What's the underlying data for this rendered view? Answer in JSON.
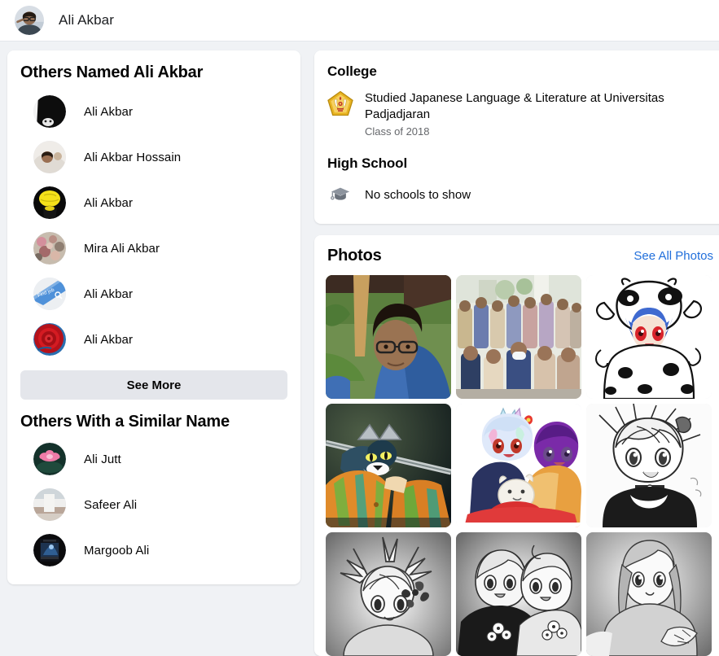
{
  "header": {
    "profile_name": "Ali Akbar",
    "avatar_alt": "profile-photo-man-with-glasses"
  },
  "sidebar": {
    "others_named": {
      "title": "Others Named Ali Akbar",
      "people": [
        {
          "name": "Ali Akbar",
          "avatar": "dark-portrait"
        },
        {
          "name": "Ali Akbar Hossain",
          "avatar": "light-portrait"
        },
        {
          "name": "Ali Akbar",
          "avatar": "yellow-mask-portrait"
        },
        {
          "name": "Mira Ali Akbar",
          "avatar": "floral-group-photo"
        },
        {
          "name": "Ali Akbar",
          "avatar": "find-job-blue-banner"
        },
        {
          "name": "Ali Akbar",
          "avatar": "red-rose"
        }
      ],
      "see_more_label": "See More"
    },
    "similar_name": {
      "title": "Others With a Similar Name",
      "people": [
        {
          "name": "Ali Jutt",
          "avatar": "pink-lotus-flower"
        },
        {
          "name": "Safeer Ali",
          "avatar": "pale-interior-photo"
        },
        {
          "name": "Margoob Ali",
          "avatar": "dark-poster-artwork"
        }
      ]
    }
  },
  "education": {
    "college": {
      "heading": "College",
      "primary": "Studied Japanese Language & Literature at Universitas Padjadjaran",
      "secondary": "Class of 2018",
      "icon": "university-crest-icon"
    },
    "high_school": {
      "heading": "High School",
      "empty_text": "No schools to show",
      "icon": "graduation-cap-icon"
    }
  },
  "photos": {
    "title": "Photos",
    "see_all_label": "See All Photos",
    "tiles": [
      {
        "alt": "man-with-glasses-outdoors",
        "kind": "portrait-outdoor"
      },
      {
        "alt": "group-photo-in-yukata",
        "kind": "group-photo"
      },
      {
        "alt": "anime-girl-in-cow-hood",
        "kind": "anime-cow"
      },
      {
        "alt": "anime-cat-with-sword",
        "kind": "anime-cat-sword"
      },
      {
        "alt": "two-anime-girls-with-cat",
        "kind": "anime-duo-color"
      },
      {
        "alt": "monochrome-anime-boy-smiling",
        "kind": "anime-mono-1"
      },
      {
        "alt": "monochrome-anime-boy-with-flower",
        "kind": "anime-mono-2"
      },
      {
        "alt": "monochrome-anime-couple",
        "kind": "anime-mono-3"
      },
      {
        "alt": "monochrome-anime-long-hair",
        "kind": "anime-mono-4"
      }
    ]
  },
  "colors": {
    "page_background": "#f0f2f5",
    "card_background": "#ffffff",
    "link_blue": "#216fdb",
    "button_gray": "#e4e6eb",
    "secondary_text": "#65676b",
    "crest_gold": "#e8b422"
  }
}
